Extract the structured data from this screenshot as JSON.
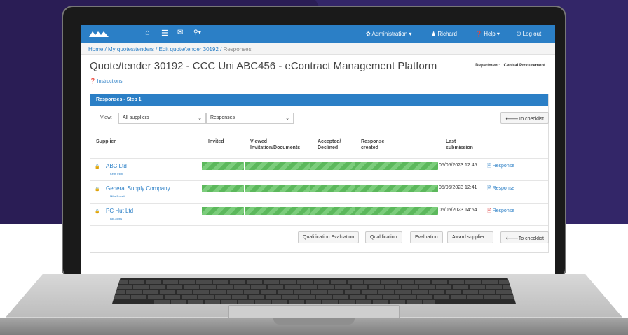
{
  "navbar": {
    "icons": [
      "logo-icon",
      "home-icon",
      "list-icon",
      "envelope-icon",
      "sitemap-icon"
    ],
    "administration": "Administration",
    "user": "Richard",
    "help": "Help",
    "logout": "Log out"
  },
  "breadcrumb": {
    "home": "Home",
    "sep": " / ",
    "quotes": "My quotes/tenders",
    "edit": "Edit quote/tender 30192",
    "current": "Responses"
  },
  "page": {
    "title": "Quote/tender  30192 - CCC Uni ABC456 - eContract Management Platform",
    "department_label": "Department:",
    "department_value": "Central Procurement",
    "instructions": "Instructions"
  },
  "panel": {
    "heading": "Responses - Step 1",
    "view_label": "View:",
    "view_select": "All suppliers",
    "mode_select": "Responses",
    "to_checklist": "To checklist"
  },
  "table": {
    "headers": [
      "Supplier",
      "Invited",
      "Viewed Invitation/Documents",
      "Accepted/ Declined",
      "Response created",
      "Last submission"
    ],
    "rows": [
      {
        "supplier": "ABC Ltd",
        "contact": "Keith Flint",
        "last": "05/05/2023 12:45",
        "response": "Response"
      },
      {
        "supplier": "General Supply Company",
        "contact": "Mike Rossti",
        "last": "05/05/2023 12:41",
        "response": "Response"
      },
      {
        "supplier": "PC Hut Ltd",
        "contact": "Bill Jobbs",
        "last": "05/05/2023 14:54",
        "response": "Response"
      }
    ]
  },
  "actions": {
    "qualification_evaluation": "Qualification Evaluation",
    "qualification": "Qualification",
    "evaluation": "Evaluation",
    "award": "Award supplier...",
    "to_checklist": "To checklist"
  },
  "colors": {
    "brand_blue": "#2b7fc6",
    "progress_green": "#5cb85c",
    "background_purple": "#2a1d55"
  }
}
